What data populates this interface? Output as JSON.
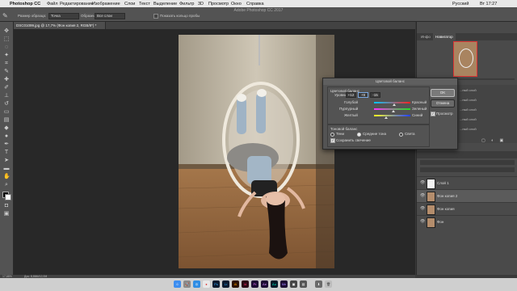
{
  "menubar": {
    "apple": "",
    "app_name": "Photoshop CC",
    "items": [
      "Файл",
      "Редактирование",
      "Изображение",
      "Слои",
      "Текст",
      "Выделение",
      "Фильтр",
      "3D",
      "Просмотр",
      "Окно",
      "Справка"
    ],
    "user": "Русский",
    "clock": "Вт 17:27"
  },
  "app_title": "Adobe Photoshop CC 2017",
  "options": {
    "sample_size_label": "Размер образца:",
    "sample_size_value": "Точка",
    "sample_label": "Образец:",
    "sample_value": "Все слои",
    "show_ring_label": "Показать кольцо пробы"
  },
  "document_tab": "DSC01099.jpg @ 17,7% (Фон копия 2, RGB/8*) *",
  "right_panel": {
    "top_tabs": [
      "Инфо",
      "Навигатор"
    ],
    "active_top_tab": "Навигатор",
    "layers": [
      {
        "name": "Слой 1",
        "visible": true
      },
      {
        "name": "Фон копия 2",
        "visible": true
      },
      {
        "name": "Фон копия",
        "visible": true
      },
      {
        "name": "Фон",
        "visible": true
      }
    ],
    "partial_labels": [
      "...ный слой",
      "...ный слой",
      "...ный слой",
      "...ный слой",
      "...ный слой"
    ]
  },
  "dialog": {
    "title": "Цветовой баланс",
    "color_balance_group": "Цветовой баланс",
    "levels_label": "Уровни:",
    "levels": [
      "+12",
      "+9",
      "-15"
    ],
    "sliders": [
      {
        "left": "Голубой",
        "right": "Красный",
        "value": 12
      },
      {
        "left": "Пурпурный",
        "right": "Зеленый",
        "value": 9
      },
      {
        "left": "Желтый",
        "right": "Синий",
        "value": -15
      }
    ],
    "tone_group": "Тоновой баланс",
    "tones": [
      "Тени",
      "Средние тона",
      "Света"
    ],
    "selected_tone": "Средние тона",
    "preserve_luminosity": "Сохранить свечение",
    "preserve_checked": true,
    "ok": "OK",
    "cancel": "Отмена",
    "preview": "Просмотр",
    "preview_checked": true
  },
  "status_bar": {
    "zoom": "17,68%",
    "doc": "Док: 8,86М/12,0М"
  },
  "dock_icons": [
    "finder-icon",
    "launchpad-icon",
    "safari-icon",
    "chrome-icon",
    "photoshop-icon",
    "lightroom-icon",
    "illustrator-icon",
    "indesign-icon",
    "premiere-icon",
    "bridge-icon",
    "audition-icon",
    "media-encoder-icon",
    "app-icon",
    "app-icon",
    "trash-icon"
  ]
}
